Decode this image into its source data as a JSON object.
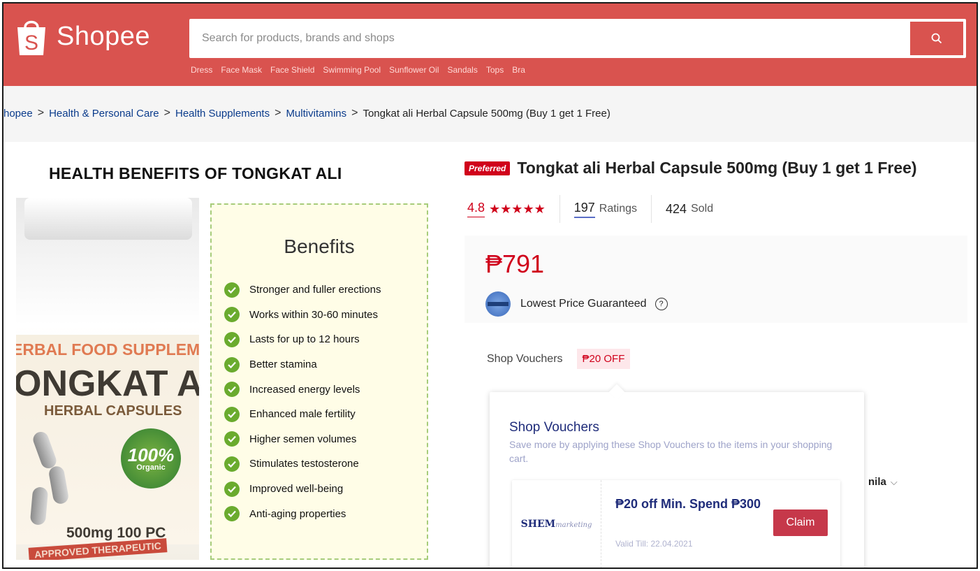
{
  "header": {
    "brand": "Shopee",
    "search": {
      "placeholder": "Search for products, brands and shops"
    },
    "quick_links": [
      "Dress",
      "Face Mask",
      "Face Shield",
      "Swimming Pool",
      "Sunflower Oil",
      "Sandals",
      "Tops",
      "Bra"
    ]
  },
  "breadcrumb": {
    "items": [
      "hopee",
      "Health & Personal Care",
      "Health Supplements",
      "Multivitamins"
    ],
    "current": "Tongkat ali Herbal Capsule 500mg (Buy 1 get 1 Free)"
  },
  "image": {
    "heading": "HEALTH BENEFITS OF TONGKAT ALI",
    "label_line1": "ERBAL FOOD SUPPLEM",
    "label_line2": "ONGKAT A",
    "label_line3": "HERBAL CAPSULES",
    "badge_big": "100%",
    "badge_small": "Organic",
    "size_text": "500mg   100 PC",
    "band_text": "APPROVED THERAPEUTIC",
    "benefits_title": "Benefits",
    "benefits": [
      "Stronger and fuller erections",
      "Works within 30-60 minutes",
      "Lasts for up to 12 hours",
      "Better stamina",
      "Increased energy levels",
      "Enhanced male fertility",
      "Higher semen volumes",
      "Stimulates testosterone",
      "Improved well-being",
      "Anti-aging properties"
    ]
  },
  "product": {
    "badge": "Preferred",
    "title": "Tongkat ali Herbal Capsule 500mg (Buy 1 get 1 Free)",
    "rating": "4.8",
    "stars": "★★★★★",
    "ratings_count": "197",
    "ratings_label": "Ratings",
    "sold_count": "424",
    "sold_label": "Sold",
    "price": "₱791",
    "guarantee": "Lowest Price Guaranteed",
    "voucher_label": "Shop Vouchers",
    "voucher_tag": "₱20 OFF",
    "location_partial": "nila"
  },
  "voucher_popover": {
    "title": "Shop Vouchers",
    "subtitle": "Save more by applying these Shop Vouchers to the items in your shopping cart.",
    "card": {
      "shop_logo": "SHEM",
      "shop_logo_script": "marketing",
      "title": "₱20 off Min. Spend ₱300",
      "valid": "Valid Till: 22.04.2021",
      "claim": "Claim"
    }
  },
  "colors": {
    "brand": "#d9534f",
    "accent": "#d0011b",
    "voucher_text": "#1f2c7a"
  }
}
